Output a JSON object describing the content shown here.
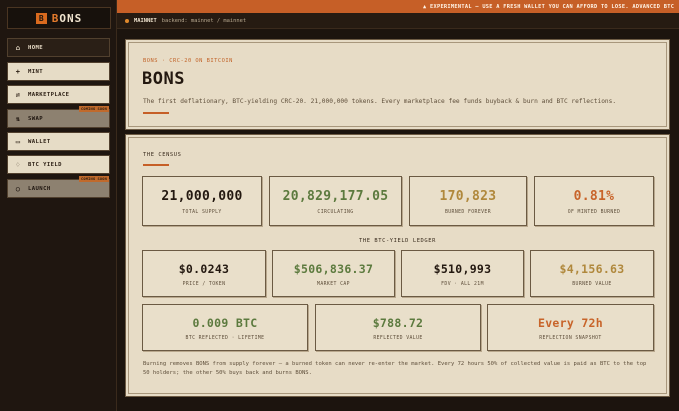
{
  "colors": {
    "accent": "#c65f27",
    "green": "#5c7a3e",
    "gold": "#b0883c",
    "orange": "#c8642a",
    "dark": "#231810"
  },
  "brand": {
    "mark": "B",
    "name_prefix": "B",
    "name_rest": "ONS"
  },
  "nav": [
    {
      "icon": "home-icon",
      "glyph": "⌂",
      "label": "HOME",
      "style": "dark"
    },
    {
      "icon": "plus-icon",
      "glyph": "+",
      "label": "MINT",
      "style": "light"
    },
    {
      "icon": "sliders-icon",
      "glyph": "⇌",
      "label": "MARKETPLACE",
      "style": "light"
    },
    {
      "icon": "swap-icon",
      "glyph": "⇅",
      "label": "SWAP",
      "style": "muted",
      "badge": "COMING SOON"
    },
    {
      "icon": "wallet-icon",
      "glyph": "▭",
      "label": "WALLET",
      "style": "light"
    },
    {
      "icon": "flame-icon",
      "glyph": "♢",
      "label": "BTC YIELD",
      "style": "light"
    },
    {
      "icon": "rocket-icon",
      "glyph": "○",
      "label": "LAUNCH",
      "style": "muted",
      "badge": "COMING SOON"
    }
  ],
  "banner": {
    "icon": "warning-icon",
    "text": "▲ EXPERIMENTAL — USE A FRESH WALLET YOU CAN AFFORD TO LOSE. ADVANCED BTC"
  },
  "network": {
    "name": "MAINNET",
    "backend": "backend: mainnet / mainnet"
  },
  "hero": {
    "eyebrow": "BONS · CRC-20 ON BITCOIN",
    "title": "BONS",
    "description": "The first deflationary, BTC-yielding CRC-20. 21,000,000 tokens. Every marketplace fee funds buyback & burn and BTC reflections."
  },
  "census": {
    "title": "THE CENSUS",
    "stats": [
      {
        "value": "21,000,000",
        "label": "TOTAL SUPPLY",
        "color": "#231810"
      },
      {
        "value": "20,829,177.05",
        "label": "CIRCULATING",
        "color": "#5c7a3e"
      },
      {
        "value": "170,823",
        "label": "BURNED FOREVER",
        "color": "#b0883c"
      },
      {
        "value": "0.81%",
        "label": "OF MINTED BURNED",
        "color": "#c8642a"
      }
    ],
    "ledger_title": "THE BTC-YIELD LEDGER",
    "ledger": [
      {
        "value": "$0.0243",
        "label": "PRICE / TOKEN",
        "color": "#231810"
      },
      {
        "value": "$506,836.37",
        "label": "MARKET CAP",
        "color": "#5c7a3e"
      },
      {
        "value": "$510,993",
        "label": "FDV · ALL 21M",
        "color": "#231810"
      },
      {
        "value": "$4,156.63",
        "label": "BURNED VALUE",
        "color": "#b0883c"
      }
    ],
    "reflect": [
      {
        "value": "0.009 BTC",
        "label": "BTC REFLECTED · LIFETIME",
        "color": "#5c7a3e"
      },
      {
        "value": "$788.72",
        "label": "REFLECTED VALUE",
        "color": "#5c7a3e"
      },
      {
        "value": "Every 72h",
        "label": "REFLECTION SNAPSHOT",
        "color": "#c8642a"
      }
    ],
    "footnote": "Burning removes BONS from supply forever — a burned token can never re-enter the market. Every 72 hours 50% of collected value is paid as BTC to the top 50 holders; the other 50% buys back and burns BONS."
  }
}
